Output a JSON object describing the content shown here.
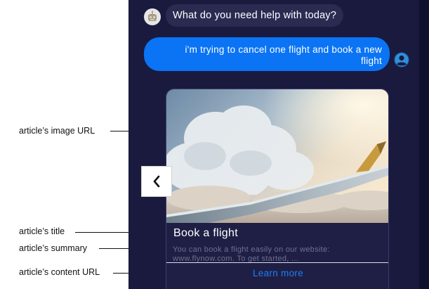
{
  "annotations": {
    "image_url": "article’s image URL",
    "title": "article’s title",
    "summary": "article’s summary",
    "content_url": "article’s content URL"
  },
  "chat": {
    "bot_message": "What do you need help with today?",
    "user_message_line1": "i'm trying to cancel one flight and book a new",
    "user_message_line2": "flight"
  },
  "article_card": {
    "title": "Book a flight",
    "summary": "You can book a flight easily on our website: www.flynow.com. To get started, ...",
    "link_label": "Learn more"
  },
  "icons": {
    "bot_avatar": "robot-icon",
    "user_avatar": "user-icon",
    "prev_button": "chevron-left-icon"
  },
  "colors": {
    "panel_background": "#1a1a3f",
    "user_bubble": "#0a74f5",
    "bot_bubble": "#2b2b52",
    "link": "#1e7ef2"
  }
}
